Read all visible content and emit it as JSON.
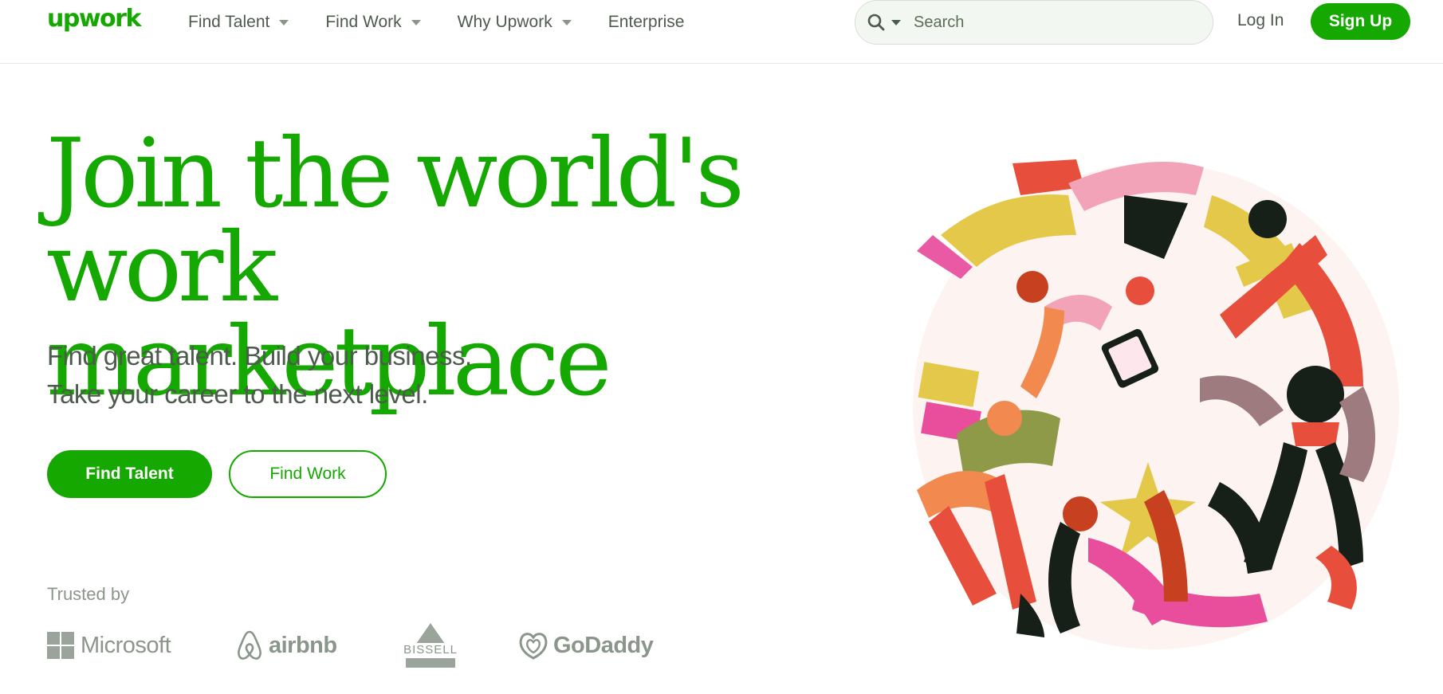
{
  "header": {
    "logo": "upwork",
    "nav": [
      {
        "label": "Find Talent",
        "dropdown": true
      },
      {
        "label": "Find Work",
        "dropdown": true
      },
      {
        "label": "Why Upwork",
        "dropdown": true
      },
      {
        "label": "Enterprise",
        "dropdown": false
      }
    ],
    "search": {
      "placeholder": "Search"
    },
    "login_label": "Log In",
    "signup_label": "Sign Up"
  },
  "hero": {
    "title_line1": "Join the world's",
    "title_line2": "work marketplace",
    "subtitle_line1": "Find great talent. Build your business.",
    "subtitle_line2": "Take your career to the next level.",
    "primary_cta": "Find Talent",
    "secondary_cta": "Find Work"
  },
  "trusted": {
    "label": "Trusted by",
    "logos": [
      "Microsoft",
      "airbnb",
      "BISSELL",
      "GoDaddy"
    ]
  },
  "icons": {
    "search": "search-icon",
    "dropdown": "chevron-down-icon"
  },
  "colors": {
    "brand_green": "#14a800",
    "text_gray": "#4d5b4d",
    "muted_gray": "#8a968a"
  }
}
